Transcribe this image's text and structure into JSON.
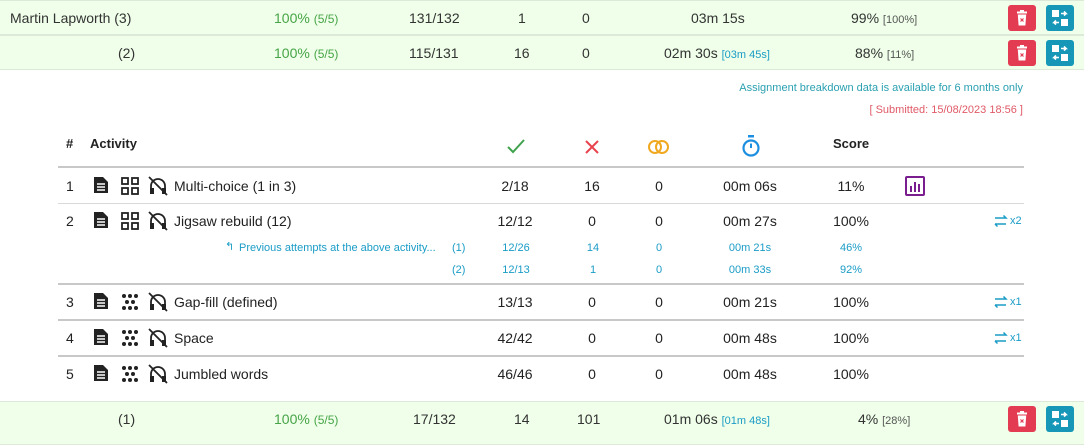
{
  "summary_rows": [
    {
      "name": "Martin Lapworth (3)",
      "completion": "100%",
      "completion_detail": "(5/5)",
      "correct": "131/132",
      "incorrect": "1",
      "skipped": "0",
      "time": "03m 15s",
      "time_detail": "",
      "score": "99%",
      "score_detail": "[100%]"
    },
    {
      "name": "(2)",
      "completion": "100%",
      "completion_detail": "(5/5)",
      "correct": "115/131",
      "incorrect": "16",
      "skipped": "0",
      "time": "02m 30s",
      "time_detail": "[03m 45s]",
      "score": "88%",
      "score_detail": "[11%]"
    },
    {
      "name": "(1)",
      "completion": "100%",
      "completion_detail": "(5/5)",
      "correct": "17/132",
      "incorrect": "14",
      "skipped": "101",
      "time": "01m 06s",
      "time_detail": "[01m 48s]",
      "score": "4%",
      "score_detail": "[28%]"
    }
  ],
  "detail": {
    "availability_note": "Assignment breakdown data is available for 6 months only",
    "submitted": "[ Submitted: 15/08/2023 18:56 ]",
    "headers": {
      "num": "#",
      "activity": "Activity",
      "score": "Score"
    },
    "header_icons": {
      "correct": "check-icon",
      "incorrect": "cross-icon",
      "skipped": "skip-circles-icon",
      "time": "stopwatch-icon"
    },
    "colors": {
      "correct": "#3fa34d",
      "incorrect": "#e8424e",
      "skipped": "#f0a81f",
      "time": "#1d8fe0",
      "chart": "#7a1d8f",
      "link": "#1a9cc6"
    },
    "activities": [
      {
        "num": "1",
        "name": "Multi-choice (1 in 3)",
        "type_icon": "grid-icon",
        "correct": "2/18",
        "incorrect": "16",
        "skipped": "0",
        "time": "00m 06s",
        "score": "11%",
        "extra": "chart-icon",
        "retries": ""
      },
      {
        "num": "2",
        "name": "Jigsaw rebuild (12)",
        "type_icon": "grid-icon",
        "correct": "12/12",
        "incorrect": "0",
        "skipped": "0",
        "time": "00m 27s",
        "score": "100%",
        "extra": "",
        "retries": "x2"
      },
      {
        "num": "3",
        "name": "Gap-fill (defined)",
        "type_icon": "dots-icon",
        "correct": "13/13",
        "incorrect": "0",
        "skipped": "0",
        "time": "00m 21s",
        "score": "100%",
        "extra": "",
        "retries": "x1"
      },
      {
        "num": "4",
        "name": "Space",
        "type_icon": "dots-icon",
        "correct": "42/42",
        "incorrect": "0",
        "skipped": "0",
        "time": "00m 48s",
        "score": "100%",
        "extra": "",
        "retries": "x1"
      },
      {
        "num": "5",
        "name": "Jumbled words",
        "type_icon": "dots-icon",
        "correct": "46/46",
        "incorrect": "0",
        "skipped": "0",
        "time": "00m 48s",
        "score": "100%",
        "extra": "",
        "retries": ""
      }
    ],
    "previous_label": "Previous attempts at the above activity...",
    "previous_attempts": [
      {
        "attempt": "(1)",
        "correct": "12/26",
        "incorrect": "14",
        "skipped": "0",
        "time": "00m 21s",
        "score": "46%"
      },
      {
        "attempt": "(2)",
        "correct": "12/13",
        "incorrect": "1",
        "skipped": "0",
        "time": "00m 33s",
        "score": "92%"
      }
    ]
  }
}
